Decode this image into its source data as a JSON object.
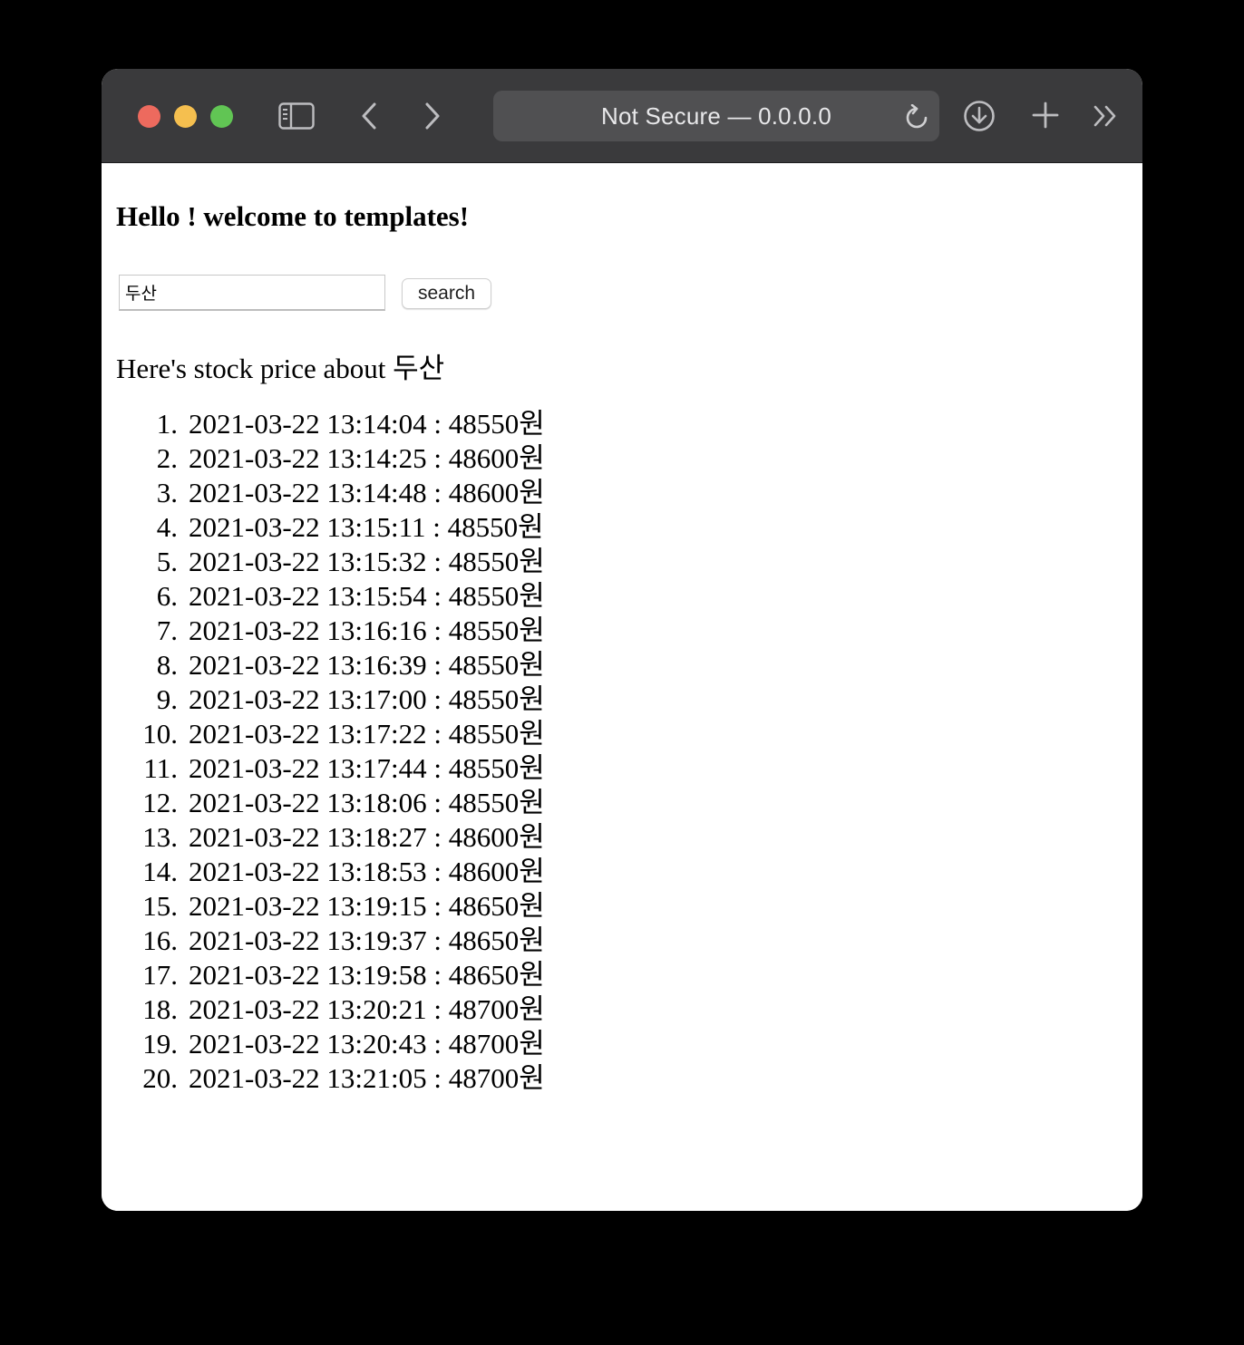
{
  "browser": {
    "address_text": "Not Secure — 0.0.0.0",
    "icons": [
      "sidebar-icon",
      "back-icon",
      "forward-icon",
      "reload-icon",
      "download-icon",
      "new-tab-icon",
      "more-icon"
    ]
  },
  "page": {
    "greeting": "Hello ! welcome to templates!",
    "search": {
      "value": "두산",
      "button_label": "search"
    },
    "result_heading": "Here's stock price about 두산",
    "prices": [
      {
        "num": "1.",
        "text": "2021-03-22 13:14:04 : 48550원"
      },
      {
        "num": "2.",
        "text": "2021-03-22 13:14:25 : 48600원"
      },
      {
        "num": "3.",
        "text": "2021-03-22 13:14:48 : 48600원"
      },
      {
        "num": "4.",
        "text": "2021-03-22 13:15:11 : 48550원"
      },
      {
        "num": "5.",
        "text": "2021-03-22 13:15:32 : 48550원"
      },
      {
        "num": "6.",
        "text": "2021-03-22 13:15:54 : 48550원"
      },
      {
        "num": "7.",
        "text": "2021-03-22 13:16:16 : 48550원"
      },
      {
        "num": "8.",
        "text": "2021-03-22 13:16:39 : 48550원"
      },
      {
        "num": "9.",
        "text": "2021-03-22 13:17:00 : 48550원"
      },
      {
        "num": "10.",
        "text": "2021-03-22 13:17:22 : 48550원"
      },
      {
        "num": "11.",
        "text": "2021-03-22 13:17:44 : 48550원"
      },
      {
        "num": "12.",
        "text": "2021-03-22 13:18:06 : 48550원"
      },
      {
        "num": "13.",
        "text": "2021-03-22 13:18:27 : 48600원"
      },
      {
        "num": "14.",
        "text": "2021-03-22 13:18:53 : 48600원"
      },
      {
        "num": "15.",
        "text": "2021-03-22 13:19:15 : 48650원"
      },
      {
        "num": "16.",
        "text": "2021-03-22 13:19:37 : 48650원"
      },
      {
        "num": "17.",
        "text": "2021-03-22 13:19:58 : 48650원"
      },
      {
        "num": "18.",
        "text": "2021-03-22 13:20:21 : 48700원"
      },
      {
        "num": "19.",
        "text": "2021-03-22 13:20:43 : 48700원"
      },
      {
        "num": "20.",
        "text": "2021-03-22 13:21:05 : 48700원"
      }
    ]
  }
}
